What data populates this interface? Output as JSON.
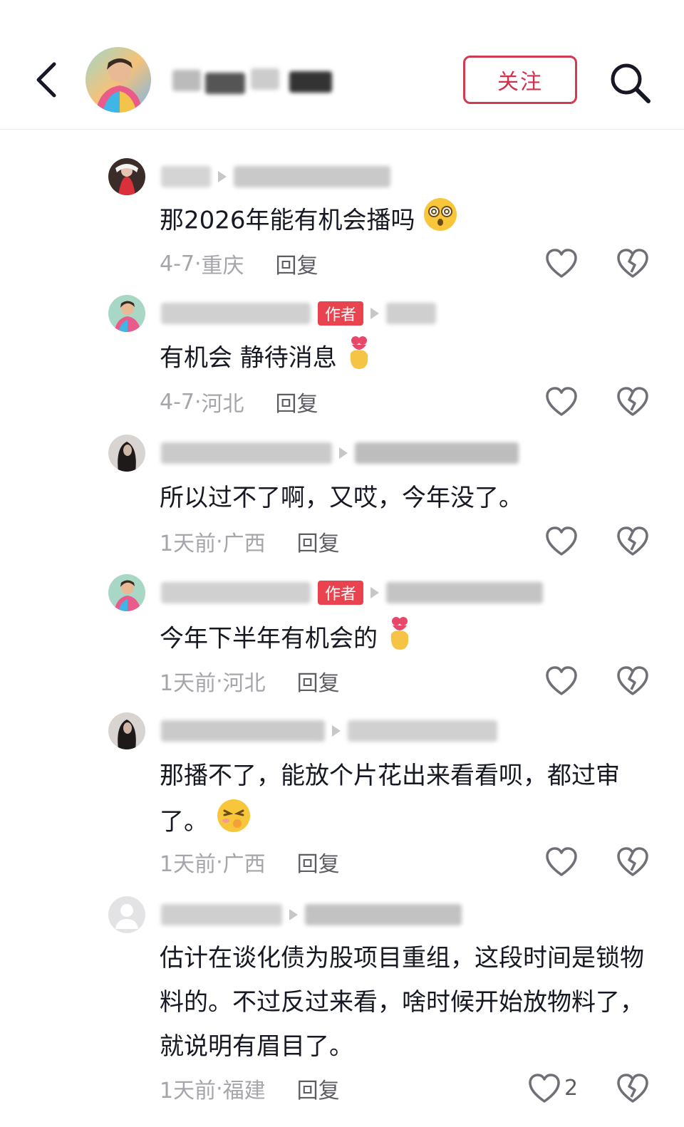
{
  "header": {
    "back_icon": "chevron-left-icon",
    "follow_label": "关注",
    "search_icon": "search-icon"
  },
  "colors": {
    "accent": "#d0324b",
    "author_tag": "#e8434f",
    "meta_text": "#a5a6ab",
    "reply_text": "#5d5e64"
  },
  "comments": [
    {
      "author_tag": "",
      "text": "那2026年能有机会播吗",
      "emoji": "dizzy-face",
      "time": "4-7",
      "location": "重庆",
      "reply_label": "回复",
      "likes": ""
    },
    {
      "author_tag": "作者",
      "text": "有机会 静待消息",
      "emoji": "heart-hands",
      "time": "4-7",
      "location": "河北",
      "reply_label": "回复",
      "likes": ""
    },
    {
      "author_tag": "",
      "text": "所以过不了啊，又哎，今年没了。",
      "emoji": "",
      "time": "1天前",
      "location": "广西",
      "reply_label": "回复",
      "likes": ""
    },
    {
      "author_tag": "作者",
      "text": "今年下半年有机会的",
      "emoji": "heart-hands",
      "time": "1天前",
      "location": "河北",
      "reply_label": "回复",
      "likes": ""
    },
    {
      "author_tag": "",
      "text": "那播不了，能放个片花出来看看呗，都过审了。",
      "emoji": "sneaky-face",
      "time": "1天前",
      "location": "广西",
      "reply_label": "回复",
      "likes": ""
    },
    {
      "author_tag": "",
      "text": "估计在谈化债为股项目重组，这段时间是锁物料的。不过反过来看，啥时候开始放物料了，就说明有眉目了。",
      "emoji": "",
      "time": "1天前",
      "location": "福建",
      "reply_label": "回复",
      "likes": "2"
    }
  ]
}
